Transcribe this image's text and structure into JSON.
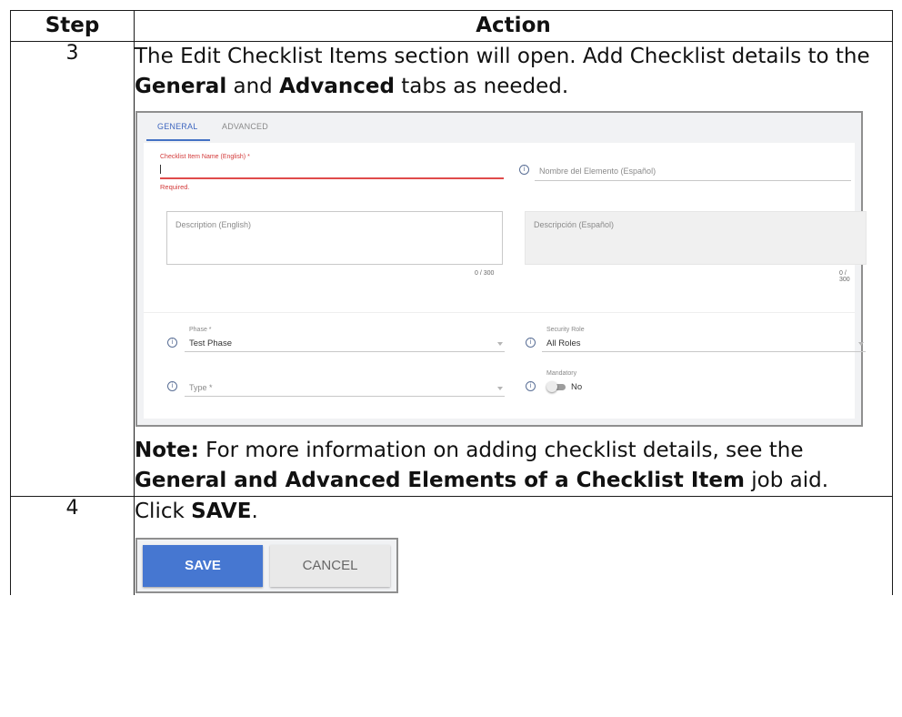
{
  "headers": {
    "step": "Step",
    "action": "Action"
  },
  "rows": [
    {
      "step": "3",
      "intro": {
        "t1": "The Edit Checklist Items section will open. Add Checklist details to the ",
        "b1": "General",
        "t2": " and ",
        "b2": "Advanced",
        "t3": " tabs as needed."
      },
      "note": {
        "label": "Note:",
        "t1": " For more information on adding checklist details, see the ",
        "b1": "General and Advanced Elements of a Checklist Item",
        "t2": " job aid."
      }
    },
    {
      "step": "4",
      "text": {
        "t1": "Click ",
        "b1": "SAVE",
        "t2": "."
      }
    }
  ],
  "form": {
    "tabs": {
      "general": "GENERAL",
      "advanced": "ADVANCED"
    },
    "name_en_label": "Checklist Item Name (English) *",
    "name_en_error": "Required.",
    "name_es_placeholder": "Nombre del Elemento (Español)",
    "desc_en_placeholder": "Description (English)",
    "desc_es_placeholder": "Descripción (Español)",
    "desc_en_counter": "0 / 300",
    "desc_es_counter": "0 / 300",
    "phase_label": "Phase *",
    "phase_value": "Test Phase",
    "security_label": "Security Role",
    "security_value": "All Roles",
    "type_placeholder": "Type *",
    "mandatory_label": "Mandatory",
    "mandatory_value": "No",
    "info_glyph": "i"
  },
  "buttons": {
    "save": "SAVE",
    "cancel": "CANCEL"
  },
  "icons": [
    "info-icon",
    "dropdown-arrow-icon",
    "toggle-switch"
  ],
  "colors": {
    "accent": "#4472c4",
    "error": "#d33a3a",
    "save_button": "#4677d1"
  }
}
